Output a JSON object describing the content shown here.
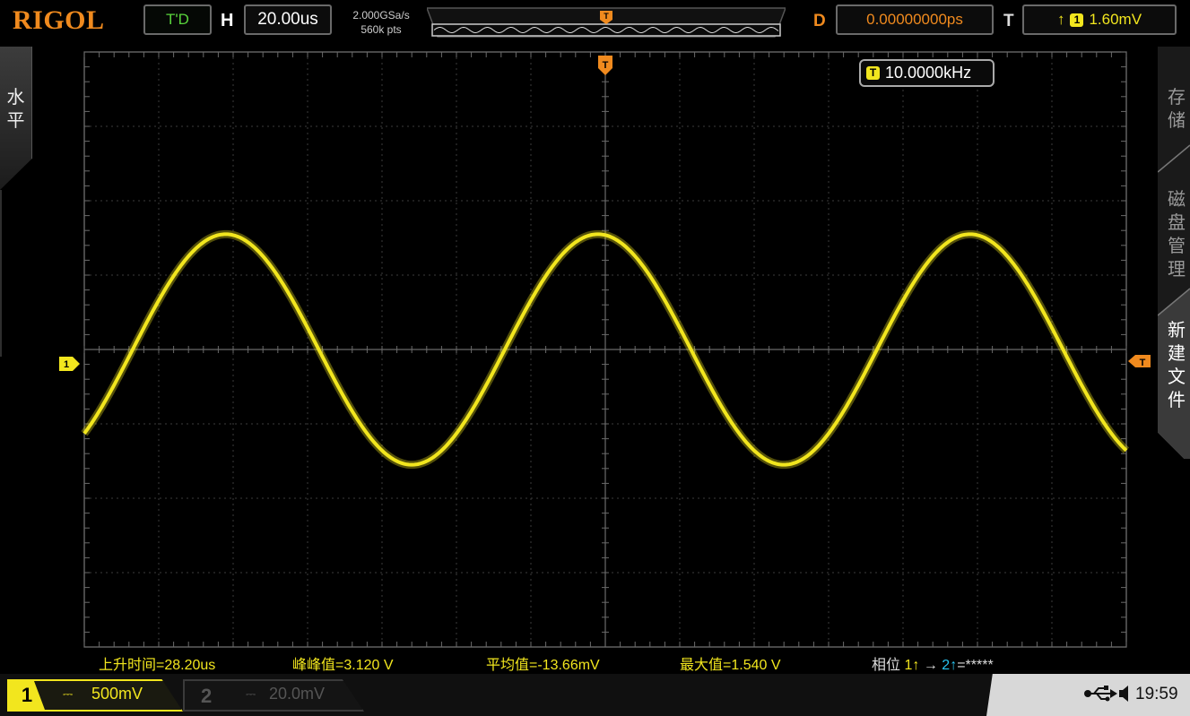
{
  "header": {
    "logo": "RIGOL",
    "run_status": "T'D",
    "horizontal_label": "H",
    "timebase": "20.00us",
    "sample_rate": "2.000GSa/s",
    "memory_depth": "560k pts",
    "delay_label": "D",
    "delay_value": "0.00000000ps",
    "trigger_label": "T",
    "trigger_edge": "↑",
    "trigger_channel": "1",
    "trigger_level": "1.60mV"
  },
  "left_tab": {
    "label": "水平"
  },
  "right_tabs": [
    {
      "label": "存储"
    },
    {
      "label": "磁盘管理"
    },
    {
      "label": "新建文件"
    }
  ],
  "markers": {
    "trigger_position": "T",
    "channel1_offset": "1",
    "trigger_level": "T"
  },
  "frequency": {
    "badge": "T",
    "value": "10.0000kHz"
  },
  "measurements": {
    "rise_time": "上升时间=28.20us",
    "vpp": "峰峰值=3.120 V",
    "mean": "平均值=-13.66mV",
    "max": "最大值=1.540 V",
    "phase_label": "相位",
    "phase_src1": "1",
    "phase_arrow": "→",
    "phase_src2": "2",
    "phase_value": "=*****"
  },
  "channels": [
    {
      "number": "1",
      "coupling": "⎓",
      "scale": "500mV",
      "active": true
    },
    {
      "number": "2",
      "coupling": "⎓",
      "scale": "20.0mV",
      "active": false
    }
  ],
  "status": {
    "usb_icon": "usb-icon",
    "time": "19:59"
  },
  "colors": {
    "ch1": "#f2e61e",
    "trigger": "#f08a1e",
    "run_status": "#59d43c",
    "ch2": "#27c3ef",
    "grid": "#3c3c3c"
  },
  "waveform": {
    "frequency_hz": 10000,
    "amplitude_divisions": 3.1,
    "offset_divisions": 0,
    "phase_cycles_at_left": 0.87,
    "horizontal_divisions": 14,
    "vertical_divisions": 8
  }
}
